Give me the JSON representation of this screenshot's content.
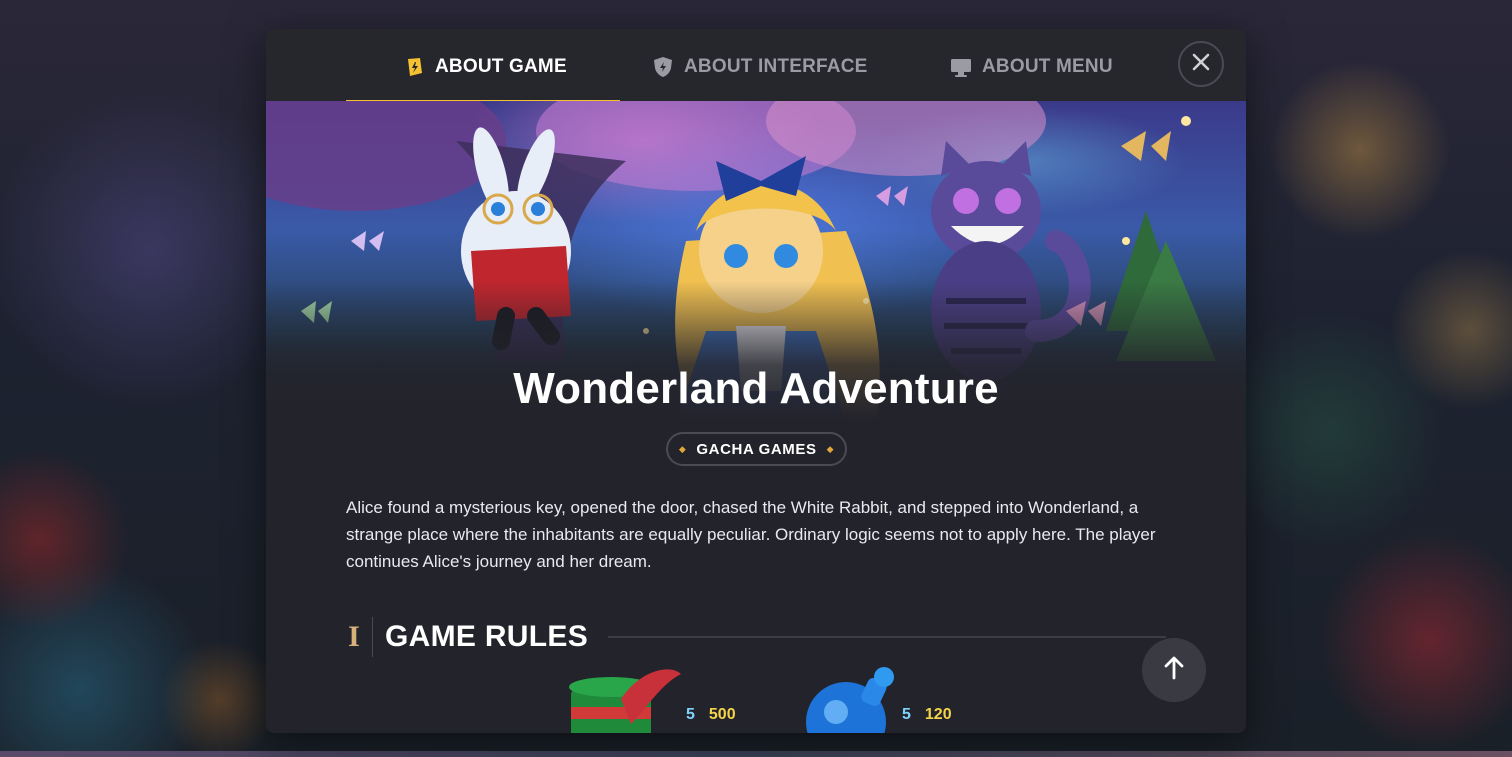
{
  "tabs": [
    {
      "label": "ABOUT GAME",
      "icon": "game-badge-icon",
      "active": true
    },
    {
      "label": "ABOUT INTERFACE",
      "icon": "shield-icon",
      "active": false
    },
    {
      "label": "ABOUT MENU",
      "icon": "monitor-icon",
      "active": false
    }
  ],
  "close_icon": "close-icon",
  "game": {
    "title": "Wonderland Adventure",
    "category": "GACHA GAMES",
    "description": "Alice found a mysterious key, opened the door, chased the White Rabbit, and stepped into Wonderland, a strange place where the inhabitants are equally peculiar. Ordinary logic seems not to apply here. The player continues Alice's journey and her dream."
  },
  "section": {
    "numeral": "I",
    "title": "GAME RULES"
  },
  "paytable": [
    {
      "symbol": "green-top-hat",
      "rows": [
        {
          "count": "5",
          "value": "500"
        }
      ]
    },
    {
      "symbol": "blue-potion-bottle",
      "rows": [
        {
          "count": "5",
          "value": "120"
        }
      ]
    }
  ],
  "scroll_top_icon": "arrow-up-icon",
  "colors": {
    "accent": "#f5c031",
    "modal_bg": "#23232b",
    "payout_count": "#7fd3ff",
    "payout_value": "#f6d44a"
  }
}
